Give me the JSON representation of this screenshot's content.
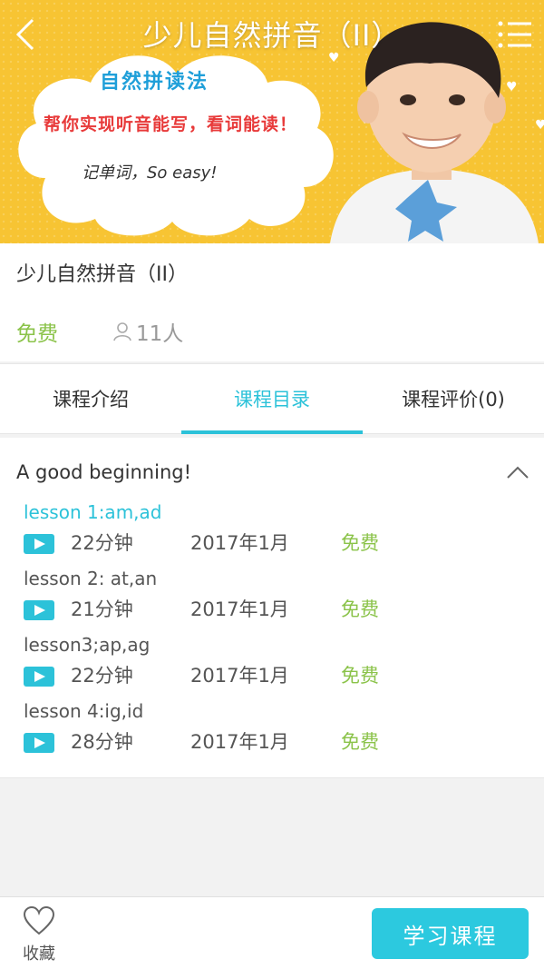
{
  "header": {
    "title": "少儿自然拼音（II）",
    "back_icon": "chevron-left-icon",
    "menu_icon": "list-menu-icon"
  },
  "banner": {
    "headline": "自然拼读法",
    "slogan": "帮你实现听音能写，看词能读！",
    "note": "记单词，So easy!",
    "bg_color": "#f7c433"
  },
  "course": {
    "title": "少儿自然拼音（II）",
    "price": "免费",
    "students": "11人"
  },
  "tabs": [
    {
      "label": "课程介绍",
      "active": false
    },
    {
      "label": "课程目录",
      "active": true
    },
    {
      "label": "课程评价(0)",
      "active": false
    }
  ],
  "catalog": {
    "section_title": "A good beginning!",
    "lessons": [
      {
        "name": "lesson 1:am,ad",
        "duration": "22分钟",
        "date": "2017年1月",
        "price": "免费",
        "current": true
      },
      {
        "name": "lesson 2: at,an",
        "duration": "21分钟",
        "date": "2017年1月",
        "price": "免费",
        "current": false
      },
      {
        "name": "lesson3;ap,ag",
        "duration": "22分钟",
        "date": "2017年1月",
        "price": "免费",
        "current": false
      },
      {
        "name": "lesson 4:ig,id",
        "duration": "28分钟",
        "date": "2017年1月",
        "price": "免费",
        "current": false
      }
    ]
  },
  "bottom": {
    "favorite_label": "收藏",
    "study_button": "学习课程"
  },
  "colors": {
    "accent": "#2cc2d9",
    "price_green": "#8bc34a"
  }
}
